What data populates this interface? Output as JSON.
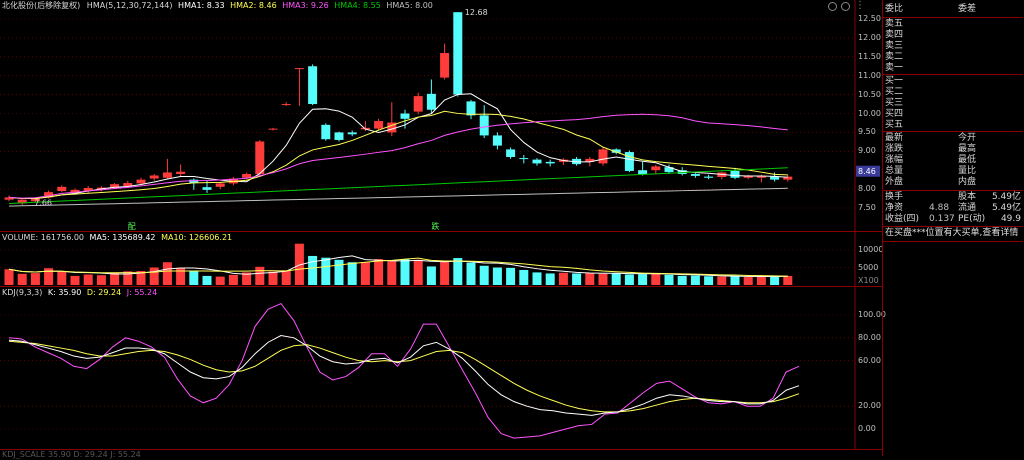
{
  "colors": {
    "up": "#ff3c3c",
    "down": "#54fcfc",
    "ma1": "#ffffff",
    "ma2": "#ffff54",
    "ma3": "#ff54ff",
    "ma4": "#00c800",
    "ma5": "#c0c0c0",
    "grid": "#8a0000",
    "kdj_k": "#ffffff",
    "kdj_d": "#ffff54",
    "kdj_j": "#ff54ff"
  },
  "price_header": {
    "stock_name": "北化股份(后移除复权)",
    "indicator": "HMA(5,12,30,72,144)",
    "ma1": "HMA1: 8.33",
    "ma2": "HMA2: 8.46",
    "ma3": "HMA3: 9.26",
    "ma4": "HMA4: 8.55",
    "ma5": "HMA5: 8.00"
  },
  "price_axis": [
    "12.50",
    "12.00",
    "11.50",
    "11.00",
    "10.50",
    "10.00",
    "9.50",
    "9.00",
    "8.46",
    "8.00",
    "7.50"
  ],
  "annotations": {
    "high": "12.68",
    "low": "7.66",
    "marker1": "配",
    "marker2": "跌"
  },
  "volume_header": {
    "title": "VOLUME: 161756.00",
    "ma5": "MA5: 135689.42",
    "ma10": "MA10: 126606.21"
  },
  "volume_axis": [
    "10000",
    "5000",
    "X100"
  ],
  "kdj_header": {
    "title": "KDJ(9,3,3)",
    "k": "K: 35.90",
    "d": "D: 29.24",
    "j": "J: 55.24"
  },
  "kdj_axis": [
    "100.00",
    "80.00",
    "60.00",
    "20.00",
    "0.00"
  ],
  "bottom_header": "KDJ_SCALE 35.90 D: 29.24 J: 55.24",
  "right_panel": {
    "title": "委比",
    "title_value": "委差",
    "sells": [
      "卖五",
      "卖四",
      "卖三",
      "卖二",
      "卖一"
    ],
    "buys": [
      "买一",
      "买二",
      "买三",
      "买四",
      "买五"
    ],
    "quote_rows": [
      {
        "l": "最新",
        "m": "今开"
      },
      {
        "l": "涨跌",
        "m": "最高"
      },
      {
        "l": "涨幅",
        "m": "最低"
      },
      {
        "l": "总量",
        "m": "量比"
      },
      {
        "l": "外盘",
        "m": "内盘"
      }
    ],
    "fin_rows": [
      {
        "l": "换手",
        "lv": "",
        "m": "股本",
        "v": "5.49亿"
      },
      {
        "l": "净资",
        "lv": "4.88",
        "m": "流通",
        "v": "5.49亿"
      },
      {
        "l": "收益(四)",
        "lv": "0.137",
        "m": "PE(动)",
        "v": "49.9"
      }
    ],
    "notice": "在买盘***位置有大买单,查看详情"
  },
  "candles": [
    [
      7.72,
      7.78,
      7.68,
      7.83
    ],
    [
      7.62,
      7.72,
      7.58,
      7.75
    ],
    [
      7.68,
      7.75,
      7.64,
      7.78
    ],
    [
      7.78,
      7.92,
      7.75,
      7.96
    ],
    [
      7.95,
      8.06,
      7.92,
      8.1
    ],
    [
      7.9,
      7.98,
      7.86,
      8.02
    ],
    [
      7.95,
      8.03,
      7.9,
      8.08
    ],
    [
      7.98,
      8.04,
      7.94,
      8.08
    ],
    [
      8.03,
      8.13,
      8.0,
      8.16
    ],
    [
      8.08,
      8.16,
      8.05,
      8.22
    ],
    [
      8.15,
      8.25,
      8.1,
      8.3
    ],
    [
      8.28,
      8.36,
      8.22,
      8.4
    ],
    [
      8.3,
      8.44,
      8.26,
      8.8
    ],
    [
      8.4,
      8.46,
      8.34,
      8.65
    ],
    [
      8.25,
      8.16,
      7.98,
      8.28
    ],
    [
      8.05,
      7.98,
      7.9,
      8.22
    ],
    [
      8.06,
      8.15,
      8.0,
      8.18
    ],
    [
      8.15,
      8.28,
      8.1,
      8.32
    ],
    [
      8.3,
      8.4,
      8.26,
      8.44
    ],
    [
      8.4,
      9.26,
      8.36,
      9.3
    ],
    [
      9.6,
      9.6,
      9.55,
      9.62
    ],
    [
      10.25,
      10.25,
      10.2,
      10.3
    ],
    [
      11.2,
      11.2,
      10.2,
      11.2
    ],
    [
      11.25,
      10.25,
      10.22,
      11.3
    ],
    [
      9.7,
      9.32,
      9.28,
      9.74
    ],
    [
      9.5,
      9.3,
      9.26,
      9.52
    ],
    [
      9.5,
      9.45,
      9.4,
      9.55
    ],
    [
      9.58,
      9.62,
      9.54,
      9.8
    ],
    [
      9.6,
      9.8,
      9.55,
      9.86
    ],
    [
      9.5,
      9.76,
      9.4,
      10.3
    ],
    [
      10.0,
      9.86,
      9.6,
      10.1
    ],
    [
      10.05,
      10.46,
      9.98,
      10.55
    ],
    [
      10.52,
      10.1,
      10.0,
      10.9
    ],
    [
      10.95,
      11.6,
      10.9,
      11.85
    ],
    [
      12.68,
      10.5,
      10.45,
      12.68
    ],
    [
      10.32,
      9.95,
      9.85,
      10.36
    ],
    [
      9.95,
      9.42,
      9.35,
      10.22
    ],
    [
      9.42,
      9.15,
      9.05,
      9.5
    ],
    [
      9.05,
      8.85,
      8.8,
      9.1
    ],
    [
      8.82,
      8.8,
      8.68,
      8.9
    ],
    [
      8.78,
      8.68,
      8.62,
      8.82
    ],
    [
      8.72,
      8.68,
      8.6,
      8.78
    ],
    [
      8.72,
      8.78,
      8.64,
      8.82
    ],
    [
      8.8,
      8.66,
      8.62,
      8.85
    ],
    [
      8.72,
      8.8,
      8.6,
      8.85
    ],
    [
      8.68,
      9.05,
      8.62,
      9.1
    ],
    [
      9.05,
      8.96,
      8.92,
      9.08
    ],
    [
      8.98,
      8.48,
      8.45,
      9.02
    ],
    [
      8.5,
      8.4,
      8.36,
      8.72
    ],
    [
      8.5,
      8.6,
      8.4,
      8.64
    ],
    [
      8.58,
      8.45,
      8.4,
      8.65
    ],
    [
      8.5,
      8.4,
      8.36,
      8.58
    ],
    [
      8.4,
      8.35,
      8.3,
      8.42
    ],
    [
      8.33,
      8.3,
      8.26,
      8.38
    ],
    [
      8.32,
      8.44,
      8.26,
      8.46
    ],
    [
      8.48,
      8.3,
      8.26,
      8.56
    ],
    [
      8.3,
      8.35,
      8.26,
      8.38
    ],
    [
      8.3,
      8.34,
      8.18,
      8.38
    ],
    [
      8.33,
      8.25,
      8.2,
      8.44
    ],
    [
      8.25,
      8.33,
      8.2,
      8.38
    ]
  ],
  "volumes": [
    4500,
    3200,
    3400,
    4800,
    3800,
    2600,
    3000,
    2800,
    3500,
    3900,
    4000,
    5000,
    6500,
    4800,
    3900,
    2600,
    2400,
    2900,
    3600,
    5200,
    3800,
    4200,
    11800,
    8300,
    7800,
    7200,
    6500,
    6500,
    7400,
    6800,
    7300,
    7200,
    5300,
    6600,
    7700,
    6400,
    5500,
    5000,
    4900,
    4300,
    3600,
    3300,
    3500,
    3300,
    3400,
    3200,
    3400,
    3000,
    3100,
    3300,
    2900,
    2600,
    2700,
    2500,
    2400,
    2500,
    2300,
    2500,
    2400,
    2600
  ],
  "kdj": {
    "k": [
      78,
      77,
      74,
      71,
      68,
      64,
      62,
      63,
      67,
      71,
      71,
      70,
      66,
      58,
      50,
      45,
      44,
      46,
      54,
      66,
      76,
      82,
      80,
      73,
      64,
      59,
      57,
      58,
      61,
      62,
      58,
      63,
      73,
      76,
      70,
      62,
      51,
      39,
      30,
      24,
      20,
      17,
      16,
      14,
      13,
      12,
      14,
      15,
      18,
      22,
      27,
      30,
      29,
      27,
      25,
      24,
      24,
      22,
      22,
      25,
      34,
      38
    ],
    "d": [
      77,
      76,
      75,
      73,
      71,
      69,
      66,
      64,
      64,
      66,
      68,
      69,
      68,
      65,
      61,
      56,
      52,
      50,
      51,
      55,
      62,
      69,
      73,
      74,
      71,
      67,
      63,
      60,
      59,
      60,
      59,
      60,
      64,
      68,
      69,
      67,
      61,
      54,
      47,
      40,
      34,
      29,
      25,
      21,
      18,
      16,
      15,
      15,
      16,
      18,
      21,
      24,
      26,
      27,
      26,
      25,
      24,
      23,
      23,
      24,
      27,
      31
    ],
    "j": [
      80,
      79,
      72,
      67,
      62,
      55,
      53,
      61,
      72,
      80,
      77,
      72,
      63,
      44,
      29,
      23,
      27,
      39,
      60,
      90,
      105,
      110,
      95,
      72,
      50,
      43,
      46,
      54,
      66,
      66,
      55,
      70,
      92,
      92,
      72,
      52,
      32,
      10,
      -4,
      -8,
      -7,
      -6,
      -3,
      0,
      3,
      4,
      13,
      14,
      23,
      32,
      40,
      42,
      35,
      28,
      23,
      22,
      24,
      20,
      20,
      27,
      50,
      55
    ]
  }
}
